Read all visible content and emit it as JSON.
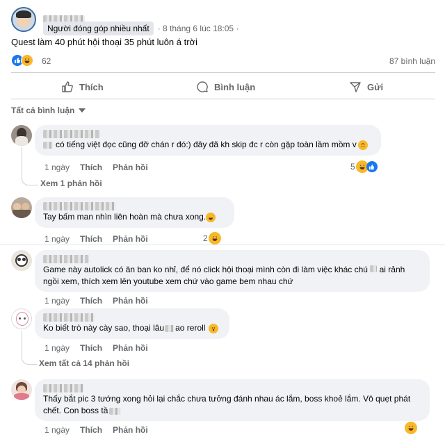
{
  "post": {
    "badge": "Người đóng góp nhiều nhất",
    "time": "· 8 tháng 6 lúc 18:05 ·",
    "text": "Quest làm 40 phút hội thoại 35 phút luôn á trời",
    "reaction_count": "62",
    "comment_count": "87 bình luận",
    "reaction_colors": {
      "like": "#1877f2",
      "haha": "#f7b928"
    }
  },
  "actions": {
    "like": "Thích",
    "comment": "Bình luận",
    "share": "Gửi"
  },
  "filter": {
    "label": "Tất cả bình luận"
  },
  "comments": [
    {
      "text": "có tiếng việt đọc cũng đỡ chán r đó:) đây đã kh skip đc r còn gặp toàn lầm mồm v",
      "time": "1 ngày",
      "like": "Thích",
      "reply": "Phản hồi",
      "reaction_count": "5",
      "view_replies": "Xem 1 phản hồi"
    },
    {
      "text": "Tay bấm man nhìn liên hoàn mà chưa xong.",
      "time": "1 ngày",
      "like": "Thích",
      "reply": "Phản hồi",
      "reaction_count": "2"
    },
    {
      "text_line1": "Game này autolick có ăn ban ko nhỉ, để nó click hội thoại mình còn đi làm việc khác chú",
      "text_line1_end": "ai rảnh",
      "text_line2": "ngồi xem, thích xem lên youtube xem chứ vào game bem nhau chứ",
      "time": "1 ngày",
      "like": "Thích",
      "reply": "Phản hồi"
    },
    {
      "text_start": "Ko biết trò này cày sao, thoại lâu",
      "text_end": "ao reroll",
      "time": "1 ngày",
      "like": "Thích",
      "reply": "Phản hồi",
      "view_replies": "Xem tất cả 14 phản hồi"
    },
    {
      "text_line1": "Thấy bắt pic 3 tướng xong hỏi lại chắc chưa tưởng đánh nhau ác lắm, boss khoẻ lắm. Vô quẹt phát",
      "text_line2": "chết. Con boss tầ",
      "time": "1 ngày",
      "like": "Thích",
      "reply": "Phản hồi"
    }
  ],
  "icons": [
    "thumbs-up-icon",
    "speech-bubble-icon",
    "send-icon",
    "haha-emoji-icon",
    "like-reaction-icon",
    "surprised-emoji-icon"
  ]
}
